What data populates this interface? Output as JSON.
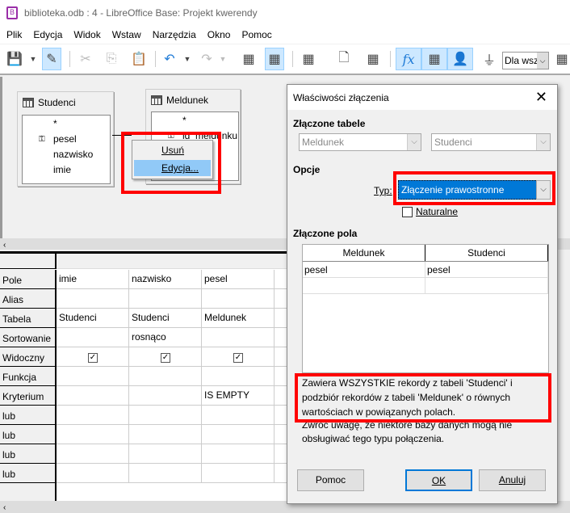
{
  "window": {
    "title": "biblioteka.odb : 4 - LibreOffice Base: Projekt kwerendy"
  },
  "menu": [
    "Plik",
    "Edycja",
    "Widok",
    "Wstaw",
    "Narzędzia",
    "Okno",
    "Pomoc"
  ],
  "toolbar": {
    "filter_combo": "Dla wsz"
  },
  "design": {
    "tables": [
      {
        "name": "Studenci",
        "fields": [
          "*",
          "pesel",
          "nazwisko",
          "imie"
        ],
        "key": "pesel"
      },
      {
        "name": "Meldunek",
        "fields": [
          "*",
          "id_meldunku"
        ],
        "key": "id_meldunku"
      }
    ],
    "context_menu": [
      "Usuń",
      "Edycja..."
    ]
  },
  "grid": {
    "row_labels": [
      "Pole",
      "Alias",
      "Tabela",
      "Sortowanie",
      "Widoczny",
      "Funkcja",
      "Kryterium",
      "lub",
      "lub",
      "lub",
      "lub"
    ],
    "columns": [
      {
        "Pole": "imie",
        "Tabela": "Studenci",
        "Sortowanie": "",
        "Widoczny": true,
        "Kryterium": ""
      },
      {
        "Pole": "nazwisko",
        "Tabela": "Studenci",
        "Sortowanie": "rosnąco",
        "Widoczny": true,
        "Kryterium": ""
      },
      {
        "Pole": "pesel",
        "Tabela": "Meldunek",
        "Sortowanie": "",
        "Widoczny": true,
        "Kryterium": "IS EMPTY"
      }
    ]
  },
  "dialog": {
    "title": "Właściwości złączenia",
    "joined_tables_label": "Złączone tabele",
    "left_table": "Meldunek",
    "right_table": "Studenci",
    "options_label": "Opcje",
    "type_label": "Typ:",
    "type_value": "Złączenie prawostronne",
    "natural_label": "Naturalne",
    "natural_checked": false,
    "joined_fields_label": "Złączone pola",
    "fields_headers": [
      "Meldunek",
      "Studenci"
    ],
    "fields_rows": [
      [
        "pesel",
        "pesel"
      ]
    ],
    "description": "Zawiera WSZYSTKIE rekordy z tabeli 'Studenci' i podzbiór rekordów z tabeli 'Meldunek' o równych wartościach w powiązanych polach.",
    "note": "Zwróć uwagę, że niektóre bazy danych mogą nie obsługiwać tego typu połączenia.",
    "help": "Pomoc",
    "ok": "OK",
    "cancel": "Anuluj"
  },
  "colors": {
    "highlight": "#f00",
    "selection": "#0078d7",
    "menu_hover": "#91c9f7"
  }
}
